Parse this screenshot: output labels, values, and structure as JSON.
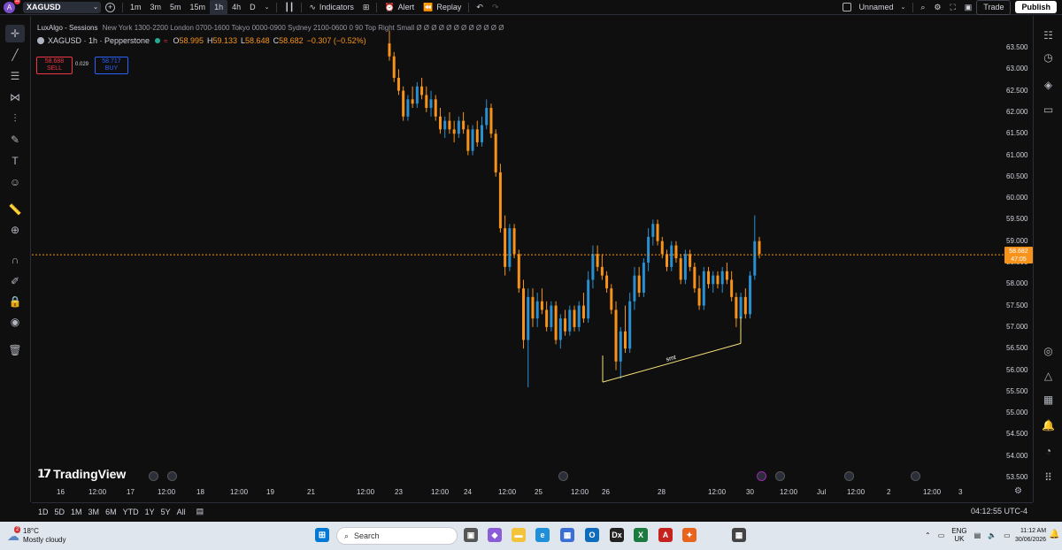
{
  "header": {
    "avatar_letter": "A",
    "avatar_badge": "11",
    "symbol": "XAGUSD",
    "timeframes": [
      "1m",
      "3m",
      "5m",
      "15m",
      "1h",
      "4h",
      "D"
    ],
    "active_timeframe": "1h",
    "indicators_label": "Indicators",
    "alert_label": "Alert",
    "replay_label": "Replay",
    "layout_name": "Unnamed",
    "trade_label": "Trade",
    "publish_label": "Publish"
  },
  "legend": {
    "indicator_name": "LuxAlgo - Sessions",
    "indicator_params": "New York 1300-2200 London 0700-1600 Tokyo 0000-0900 Sydney 2100-0600 0 90 Top Right Small Ø Ø Ø Ø Ø Ø Ø Ø Ø Ø Ø Ø",
    "symbol_title": "XAGUSD · 1h · Pepperstone",
    "open_label": "O",
    "open": "58.995",
    "high_label": "H",
    "high": "59.133",
    "low_label": "L",
    "low": "58.648",
    "close_label": "C",
    "close": "58.682",
    "change": "−0.307 (−0.52%)"
  },
  "order_panel": {
    "sell_price": "58.688",
    "sell_label": "SELL",
    "spread": "0.029",
    "buy_price": "58.717",
    "buy_label": "BUY"
  },
  "price_axis": {
    "labels": [
      "63.500",
      "63.000",
      "62.500",
      "62.000",
      "61.500",
      "61.000",
      "60.500",
      "60.000",
      "59.500",
      "59.000",
      "58.500",
      "58.000",
      "57.500",
      "57.000",
      "56.500",
      "56.000",
      "55.500",
      "55.000",
      "54.500",
      "54.000",
      "53.500"
    ],
    "current_price": "58.682",
    "countdown": "47:05"
  },
  "time_axis": {
    "labels": [
      "16",
      "12:00",
      "17",
      "12:00",
      "18",
      "12:00",
      "19",
      "21",
      "12:00",
      "23",
      "12:00",
      "24",
      "12:00",
      "25",
      "12:00",
      "26",
      "28",
      "12:00",
      "30",
      "12:00",
      "Jul",
      "12:00",
      "2",
      "12:00",
      "3"
    ]
  },
  "annotation": {
    "label": "smt",
    "start_price": 55.72,
    "end_price": 56.62,
    "color": "#f5e17a"
  },
  "brand": "TradingView",
  "bottom_bar": {
    "ranges": [
      "1D",
      "5D",
      "1M",
      "3M",
      "6M",
      "YTD",
      "1Y",
      "5Y",
      "All"
    ],
    "clock": "04:12:55 UTC-4"
  },
  "taskbar": {
    "weather_badge": "2",
    "temperature": "18°C",
    "weather_desc": "Mostly cloudy",
    "search_placeholder": "Search",
    "lang": "ENG",
    "region": "UK",
    "time": "11:12 AM",
    "date": "30/06/2026"
  },
  "colors": {
    "bull": "#2a8fd0",
    "bear": "#f7931a",
    "background": "#0f0f0f",
    "price_line": "#f7931a"
  },
  "chart_data": {
    "type": "candlestick",
    "title": "",
    "ylim": [
      53.3,
      63.9
    ],
    "candles": [
      {
        "o": 63.6,
        "h": 63.9,
        "l": 63.2,
        "c": 63.3
      },
      {
        "o": 63.3,
        "h": 63.4,
        "l": 62.7,
        "c": 62.8
      },
      {
        "o": 62.8,
        "h": 63.0,
        "l": 62.4,
        "c": 62.5
      },
      {
        "o": 62.5,
        "h": 62.6,
        "l": 61.8,
        "c": 61.9
      },
      {
        "o": 61.9,
        "h": 62.4,
        "l": 61.8,
        "c": 62.3
      },
      {
        "o": 62.3,
        "h": 62.6,
        "l": 62.1,
        "c": 62.2
      },
      {
        "o": 62.2,
        "h": 62.7,
        "l": 62.1,
        "c": 62.6
      },
      {
        "o": 62.6,
        "h": 62.8,
        "l": 62.3,
        "c": 62.4
      },
      {
        "o": 62.4,
        "h": 62.6,
        "l": 62.0,
        "c": 62.1
      },
      {
        "o": 62.1,
        "h": 62.5,
        "l": 61.9,
        "c": 62.3
      },
      {
        "o": 62.3,
        "h": 62.4,
        "l": 61.8,
        "c": 61.9
      },
      {
        "o": 61.9,
        "h": 62.1,
        "l": 61.5,
        "c": 61.6
      },
      {
        "o": 61.6,
        "h": 61.9,
        "l": 61.4,
        "c": 61.8
      },
      {
        "o": 61.8,
        "h": 62.0,
        "l": 61.5,
        "c": 61.6
      },
      {
        "o": 61.6,
        "h": 61.8,
        "l": 61.3,
        "c": 61.5
      },
      {
        "o": 61.5,
        "h": 61.9,
        "l": 61.4,
        "c": 61.8
      },
      {
        "o": 61.8,
        "h": 62.0,
        "l": 61.5,
        "c": 61.6
      },
      {
        "o": 61.6,
        "h": 61.7,
        "l": 61.0,
        "c": 61.1
      },
      {
        "o": 61.1,
        "h": 61.7,
        "l": 61.0,
        "c": 61.6
      },
      {
        "o": 61.6,
        "h": 61.8,
        "l": 61.2,
        "c": 61.3
      },
      {
        "o": 61.3,
        "h": 61.9,
        "l": 61.2,
        "c": 61.7
      },
      {
        "o": 61.7,
        "h": 62.3,
        "l": 61.6,
        "c": 62.1
      },
      {
        "o": 62.1,
        "h": 62.2,
        "l": 61.4,
        "c": 61.5
      },
      {
        "o": 61.5,
        "h": 61.6,
        "l": 60.5,
        "c": 60.6
      },
      {
        "o": 60.6,
        "h": 60.8,
        "l": 59.2,
        "c": 59.3
      },
      {
        "o": 59.3,
        "h": 59.6,
        "l": 58.2,
        "c": 58.4
      },
      {
        "o": 58.4,
        "h": 59.4,
        "l": 58.3,
        "c": 59.3
      },
      {
        "o": 59.3,
        "h": 59.4,
        "l": 58.6,
        "c": 58.7
      },
      {
        "o": 58.7,
        "h": 58.8,
        "l": 57.8,
        "c": 57.9
      },
      {
        "o": 57.9,
        "h": 58.1,
        "l": 56.5,
        "c": 56.7
      },
      {
        "o": 56.7,
        "h": 57.9,
        "l": 55.6,
        "c": 57.7
      },
      {
        "o": 57.7,
        "h": 57.9,
        "l": 57.0,
        "c": 57.2
      },
      {
        "o": 57.2,
        "h": 57.8,
        "l": 57.0,
        "c": 57.6
      },
      {
        "o": 57.6,
        "h": 57.9,
        "l": 57.3,
        "c": 57.4
      },
      {
        "o": 57.4,
        "h": 57.6,
        "l": 56.9,
        "c": 57.0
      },
      {
        "o": 57.0,
        "h": 57.6,
        "l": 56.9,
        "c": 57.5
      },
      {
        "o": 57.5,
        "h": 57.6,
        "l": 56.6,
        "c": 56.7
      },
      {
        "o": 56.7,
        "h": 57.3,
        "l": 56.5,
        "c": 57.2
      },
      {
        "o": 57.2,
        "h": 57.4,
        "l": 56.8,
        "c": 56.9
      },
      {
        "o": 56.9,
        "h": 57.5,
        "l": 56.8,
        "c": 57.4
      },
      {
        "o": 57.4,
        "h": 57.5,
        "l": 56.9,
        "c": 57.0
      },
      {
        "o": 57.0,
        "h": 57.6,
        "l": 56.9,
        "c": 57.5
      },
      {
        "o": 57.5,
        "h": 57.8,
        "l": 57.1,
        "c": 57.2
      },
      {
        "o": 57.2,
        "h": 58.3,
        "l": 57.1,
        "c": 58.1
      },
      {
        "o": 58.1,
        "h": 58.9,
        "l": 57.9,
        "c": 58.7
      },
      {
        "o": 58.7,
        "h": 58.9,
        "l": 58.3,
        "c": 58.4
      },
      {
        "o": 58.4,
        "h": 58.7,
        "l": 58.1,
        "c": 58.2
      },
      {
        "o": 58.2,
        "h": 58.3,
        "l": 57.8,
        "c": 57.9
      },
      {
        "o": 57.9,
        "h": 58.0,
        "l": 57.3,
        "c": 57.4
      },
      {
        "o": 57.4,
        "h": 57.6,
        "l": 56.0,
        "c": 56.2
      },
      {
        "o": 56.2,
        "h": 57.0,
        "l": 55.8,
        "c": 56.9
      },
      {
        "o": 56.9,
        "h": 57.5,
        "l": 56.4,
        "c": 56.5
      },
      {
        "o": 56.5,
        "h": 57.8,
        "l": 56.4,
        "c": 57.6
      },
      {
        "o": 57.6,
        "h": 58.4,
        "l": 57.4,
        "c": 58.2
      },
      {
        "o": 58.2,
        "h": 58.4,
        "l": 57.7,
        "c": 57.8
      },
      {
        "o": 57.8,
        "h": 58.6,
        "l": 57.7,
        "c": 58.5
      },
      {
        "o": 58.5,
        "h": 59.3,
        "l": 58.3,
        "c": 59.1
      },
      {
        "o": 59.1,
        "h": 59.5,
        "l": 58.9,
        "c": 59.4
      },
      {
        "o": 59.4,
        "h": 59.5,
        "l": 58.9,
        "c": 59.0
      },
      {
        "o": 59.0,
        "h": 59.1,
        "l": 58.6,
        "c": 58.7
      },
      {
        "o": 58.7,
        "h": 58.8,
        "l": 58.3,
        "c": 58.4
      },
      {
        "o": 58.4,
        "h": 59.0,
        "l": 58.3,
        "c": 58.9
      },
      {
        "o": 58.9,
        "h": 59.0,
        "l": 58.5,
        "c": 58.6
      },
      {
        "o": 58.6,
        "h": 58.7,
        "l": 58.0,
        "c": 58.1
      },
      {
        "o": 58.1,
        "h": 58.8,
        "l": 58.0,
        "c": 58.7
      },
      {
        "o": 58.7,
        "h": 58.8,
        "l": 58.3,
        "c": 58.4
      },
      {
        "o": 58.4,
        "h": 58.5,
        "l": 57.8,
        "c": 57.9
      },
      {
        "o": 57.9,
        "h": 58.2,
        "l": 57.4,
        "c": 57.5
      },
      {
        "o": 57.5,
        "h": 58.4,
        "l": 57.4,
        "c": 58.3
      },
      {
        "o": 58.3,
        "h": 58.4,
        "l": 57.9,
        "c": 58.0
      },
      {
        "o": 58.0,
        "h": 58.3,
        "l": 57.8,
        "c": 58.2
      },
      {
        "o": 58.2,
        "h": 58.3,
        "l": 57.9,
        "c": 58.0
      },
      {
        "o": 58.0,
        "h": 58.4,
        "l": 57.8,
        "c": 58.3
      },
      {
        "o": 58.3,
        "h": 58.5,
        "l": 58.0,
        "c": 58.1
      },
      {
        "o": 58.1,
        "h": 58.3,
        "l": 57.6,
        "c": 57.7
      },
      {
        "o": 57.7,
        "h": 57.8,
        "l": 57.0,
        "c": 57.2
      },
      {
        "o": 57.2,
        "h": 57.8,
        "l": 57.1,
        "c": 57.7
      },
      {
        "o": 57.7,
        "h": 57.9,
        "l": 57.2,
        "c": 57.3
      },
      {
        "o": 57.3,
        "h": 58.3,
        "l": 57.2,
        "c": 58.2
      },
      {
        "o": 58.2,
        "h": 59.6,
        "l": 58.1,
        "c": 59.0
      },
      {
        "o": 59.0,
        "h": 59.1,
        "l": 58.6,
        "c": 58.7
      }
    ]
  }
}
